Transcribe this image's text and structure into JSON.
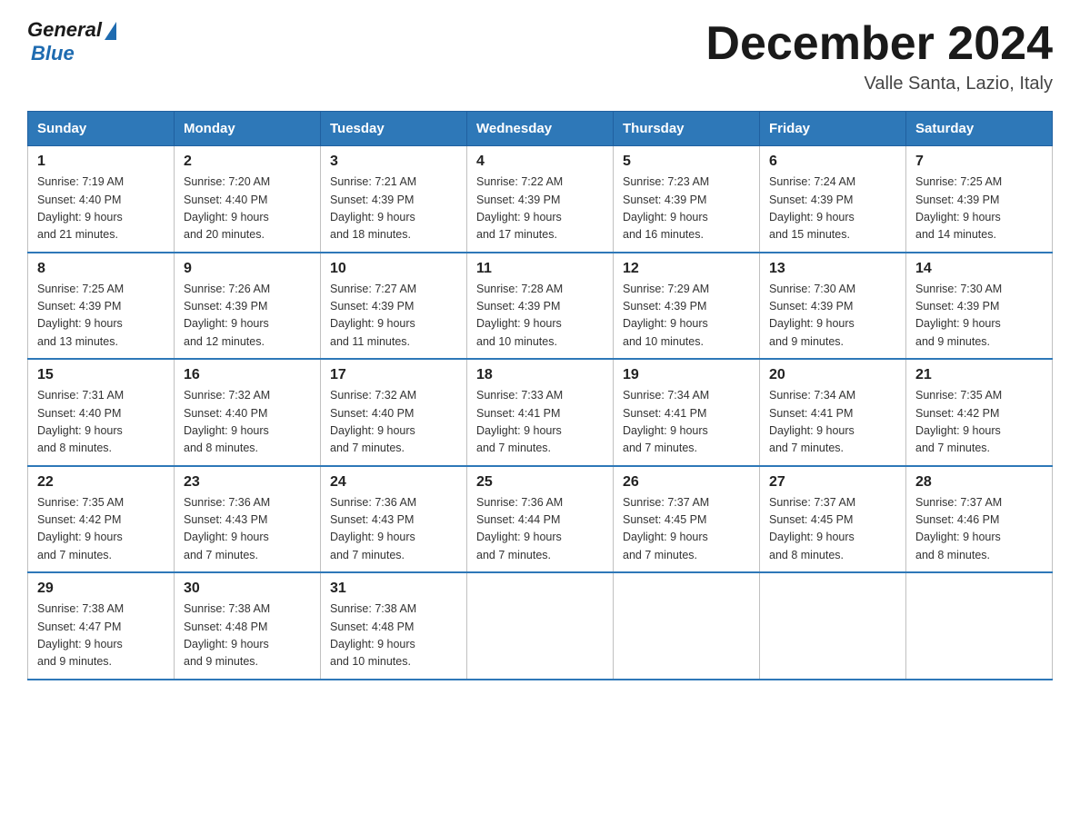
{
  "header": {
    "logo_general": "General",
    "logo_blue": "Blue",
    "month_title": "December 2024",
    "location": "Valle Santa, Lazio, Italy"
  },
  "days_of_week": [
    "Sunday",
    "Monday",
    "Tuesday",
    "Wednesday",
    "Thursday",
    "Friday",
    "Saturday"
  ],
  "weeks": [
    [
      {
        "day": "1",
        "sunrise": "7:19 AM",
        "sunset": "4:40 PM",
        "daylight": "9 hours and 21 minutes."
      },
      {
        "day": "2",
        "sunrise": "7:20 AM",
        "sunset": "4:40 PM",
        "daylight": "9 hours and 20 minutes."
      },
      {
        "day": "3",
        "sunrise": "7:21 AM",
        "sunset": "4:39 PM",
        "daylight": "9 hours and 18 minutes."
      },
      {
        "day": "4",
        "sunrise": "7:22 AM",
        "sunset": "4:39 PM",
        "daylight": "9 hours and 17 minutes."
      },
      {
        "day": "5",
        "sunrise": "7:23 AM",
        "sunset": "4:39 PM",
        "daylight": "9 hours and 16 minutes."
      },
      {
        "day": "6",
        "sunrise": "7:24 AM",
        "sunset": "4:39 PM",
        "daylight": "9 hours and 15 minutes."
      },
      {
        "day": "7",
        "sunrise": "7:25 AM",
        "sunset": "4:39 PM",
        "daylight": "9 hours and 14 minutes."
      }
    ],
    [
      {
        "day": "8",
        "sunrise": "7:25 AM",
        "sunset": "4:39 PM",
        "daylight": "9 hours and 13 minutes."
      },
      {
        "day": "9",
        "sunrise": "7:26 AM",
        "sunset": "4:39 PM",
        "daylight": "9 hours and 12 minutes."
      },
      {
        "day": "10",
        "sunrise": "7:27 AM",
        "sunset": "4:39 PM",
        "daylight": "9 hours and 11 minutes."
      },
      {
        "day": "11",
        "sunrise": "7:28 AM",
        "sunset": "4:39 PM",
        "daylight": "9 hours and 10 minutes."
      },
      {
        "day": "12",
        "sunrise": "7:29 AM",
        "sunset": "4:39 PM",
        "daylight": "9 hours and 10 minutes."
      },
      {
        "day": "13",
        "sunrise": "7:30 AM",
        "sunset": "4:39 PM",
        "daylight": "9 hours and 9 minutes."
      },
      {
        "day": "14",
        "sunrise": "7:30 AM",
        "sunset": "4:39 PM",
        "daylight": "9 hours and 9 minutes."
      }
    ],
    [
      {
        "day": "15",
        "sunrise": "7:31 AM",
        "sunset": "4:40 PM",
        "daylight": "9 hours and 8 minutes."
      },
      {
        "day": "16",
        "sunrise": "7:32 AM",
        "sunset": "4:40 PM",
        "daylight": "9 hours and 8 minutes."
      },
      {
        "day": "17",
        "sunrise": "7:32 AM",
        "sunset": "4:40 PM",
        "daylight": "9 hours and 7 minutes."
      },
      {
        "day": "18",
        "sunrise": "7:33 AM",
        "sunset": "4:41 PM",
        "daylight": "9 hours and 7 minutes."
      },
      {
        "day": "19",
        "sunrise": "7:34 AM",
        "sunset": "4:41 PM",
        "daylight": "9 hours and 7 minutes."
      },
      {
        "day": "20",
        "sunrise": "7:34 AM",
        "sunset": "4:41 PM",
        "daylight": "9 hours and 7 minutes."
      },
      {
        "day": "21",
        "sunrise": "7:35 AM",
        "sunset": "4:42 PM",
        "daylight": "9 hours and 7 minutes."
      }
    ],
    [
      {
        "day": "22",
        "sunrise": "7:35 AM",
        "sunset": "4:42 PM",
        "daylight": "9 hours and 7 minutes."
      },
      {
        "day": "23",
        "sunrise": "7:36 AM",
        "sunset": "4:43 PM",
        "daylight": "9 hours and 7 minutes."
      },
      {
        "day": "24",
        "sunrise": "7:36 AM",
        "sunset": "4:43 PM",
        "daylight": "9 hours and 7 minutes."
      },
      {
        "day": "25",
        "sunrise": "7:36 AM",
        "sunset": "4:44 PM",
        "daylight": "9 hours and 7 minutes."
      },
      {
        "day": "26",
        "sunrise": "7:37 AM",
        "sunset": "4:45 PM",
        "daylight": "9 hours and 7 minutes."
      },
      {
        "day": "27",
        "sunrise": "7:37 AM",
        "sunset": "4:45 PM",
        "daylight": "9 hours and 8 minutes."
      },
      {
        "day": "28",
        "sunrise": "7:37 AM",
        "sunset": "4:46 PM",
        "daylight": "9 hours and 8 minutes."
      }
    ],
    [
      {
        "day": "29",
        "sunrise": "7:38 AM",
        "sunset": "4:47 PM",
        "daylight": "9 hours and 9 minutes."
      },
      {
        "day": "30",
        "sunrise": "7:38 AM",
        "sunset": "4:48 PM",
        "daylight": "9 hours and 9 minutes."
      },
      {
        "day": "31",
        "sunrise": "7:38 AM",
        "sunset": "4:48 PM",
        "daylight": "9 hours and 10 minutes."
      },
      null,
      null,
      null,
      null
    ]
  ],
  "labels": {
    "sunrise": "Sunrise:",
    "sunset": "Sunset:",
    "daylight": "Daylight:"
  }
}
